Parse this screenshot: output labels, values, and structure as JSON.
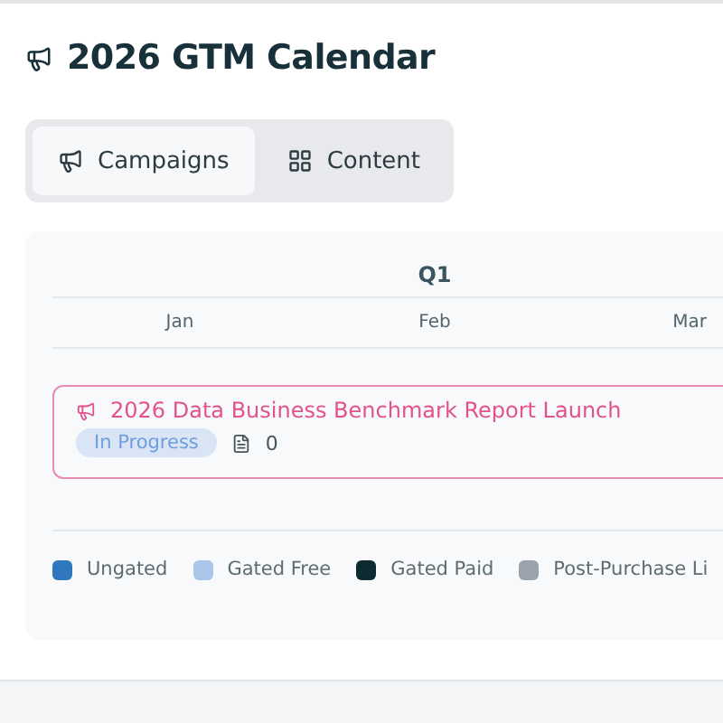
{
  "title": "2026 GTM Calendar",
  "tabs": [
    {
      "label": "Campaigns",
      "kind": "campaigns",
      "selected": true
    },
    {
      "label": "Content",
      "kind": "content",
      "selected": false
    }
  ],
  "calendar": {
    "quarter": "Q1",
    "months": [
      "Jan",
      "Feb",
      "Mar"
    ],
    "campaigns": [
      {
        "title": "2026 Data Business Benchmark Report Launch",
        "status": "In Progress",
        "content_count": "0"
      }
    ],
    "legend": [
      {
        "label": "Ungated",
        "color": "#2f78bd"
      },
      {
        "label": "Gated Free",
        "color": "#a9c6e8"
      },
      {
        "label": "Gated Paid",
        "color": "#0d2a33"
      },
      {
        "label": "Post-Purchase Li",
        "color": "#9aa3ad"
      }
    ]
  }
}
